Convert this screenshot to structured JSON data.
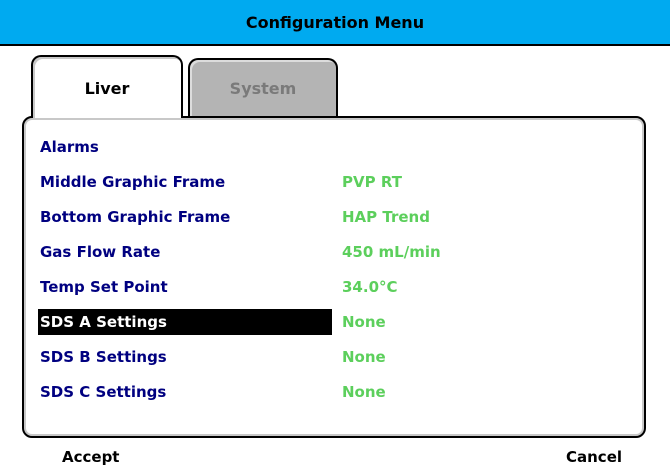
{
  "title": "Configuration Menu",
  "tabs": [
    {
      "label": "Liver",
      "active": true
    },
    {
      "label": "System",
      "active": false
    }
  ],
  "rows": [
    {
      "label": "Alarms",
      "value": ""
    },
    {
      "label": "Middle Graphic Frame",
      "value": "PVP RT"
    },
    {
      "label": "Bottom Graphic Frame",
      "value": "HAP Trend"
    },
    {
      "label": "Gas Flow Rate",
      "value": "450 mL/min"
    },
    {
      "label": "Temp Set Point",
      "value": "34.0°C"
    },
    {
      "label": "SDS A Settings",
      "value": "None",
      "selected": true
    },
    {
      "label": "SDS B Settings",
      "value": "None"
    },
    {
      "label": "SDS C Settings",
      "value": "None"
    }
  ],
  "footer": {
    "accept": "Accept",
    "cancel": "Cancel"
  },
  "colors": {
    "titlebar": "#00aaf0",
    "label_text": "#000080",
    "value_text": "#5ccf5c",
    "selected_bg": "#000000",
    "selected_text": "#ffffff",
    "inactive_tab": "#b4b4b4"
  }
}
